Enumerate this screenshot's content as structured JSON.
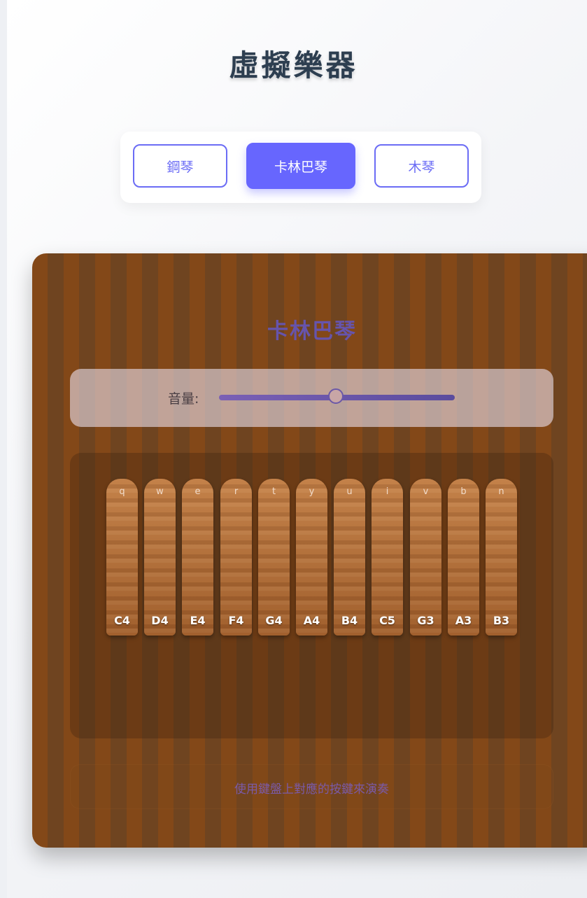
{
  "page": {
    "title": "虛擬樂器"
  },
  "instruments": {
    "items": [
      {
        "label": "鋼琴",
        "active": false
      },
      {
        "label": "卡林巴琴",
        "active": true
      },
      {
        "label": "木琴",
        "active": false
      }
    ]
  },
  "stage": {
    "title": "卡林巴琴",
    "volume": {
      "label": "音量:",
      "value": 0.5
    },
    "tines": [
      {
        "key": "q",
        "note": "C4"
      },
      {
        "key": "w",
        "note": "D4"
      },
      {
        "key": "e",
        "note": "E4"
      },
      {
        "key": "r",
        "note": "F4"
      },
      {
        "key": "t",
        "note": "G4"
      },
      {
        "key": "y",
        "note": "A4"
      },
      {
        "key": "u",
        "note": "B4"
      },
      {
        "key": "i",
        "note": "C5"
      },
      {
        "key": "v",
        "note": "G3"
      },
      {
        "key": "b",
        "note": "A3"
      },
      {
        "key": "n",
        "note": "B3"
      }
    ],
    "hint": "使用鍵盤上對應的按鍵來演奏"
  },
  "colors": {
    "accent": "#6766fe",
    "wood_dark": "#6f4420",
    "wood_light": "#834818",
    "title": "#2d3e50"
  }
}
